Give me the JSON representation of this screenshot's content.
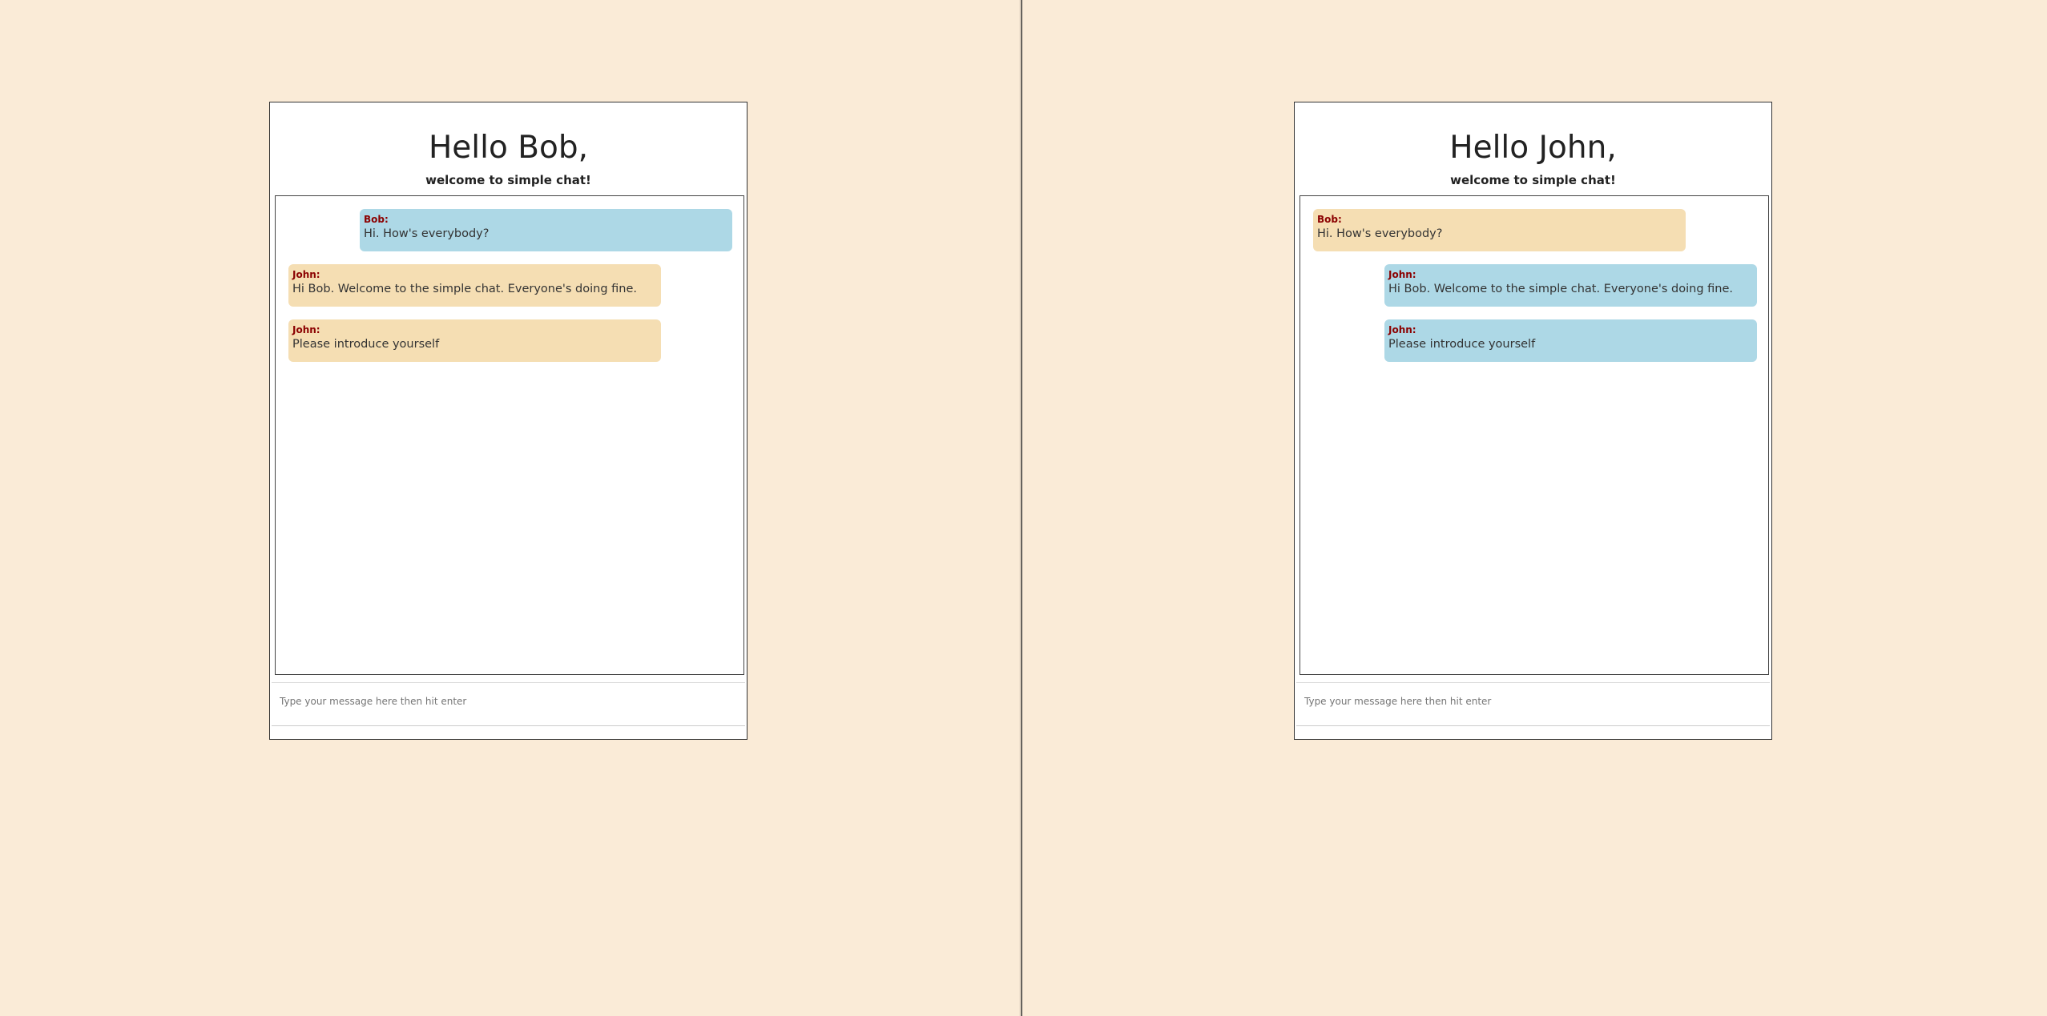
{
  "chat_left": {
    "greeting": "Hello Bob,",
    "welcome": "welcome to simple chat!",
    "messages": [
      {
        "sender": "Bob:",
        "text": "Hi. How's everybody?",
        "side": "mine"
      },
      {
        "sender": "John:",
        "text": "Hi Bob. Welcome to the simple chat. Everyone's doing fine.",
        "side": "other"
      },
      {
        "sender": "John:",
        "text": "Please introduce yourself",
        "side": "other"
      }
    ],
    "input_placeholder": "Type your message here then hit enter"
  },
  "chat_right": {
    "greeting": "Hello John,",
    "welcome": "welcome to simple chat!",
    "messages": [
      {
        "sender": "Bob:",
        "text": "Hi. How's everybody?",
        "side": "other"
      },
      {
        "sender": "John:",
        "text": "Hi Bob. Welcome to the simple chat. Everyone's doing fine.",
        "side": "mine"
      },
      {
        "sender": "John:",
        "text": "Please introduce yourself",
        "side": "mine"
      }
    ],
    "input_placeholder": "Type your message here then hit enter"
  },
  "colors": {
    "page_background": "#faebd7",
    "own_message_bubble": "#add8e6",
    "other_message_bubble": "#f5deb3",
    "sender_name": "#8b0000"
  }
}
